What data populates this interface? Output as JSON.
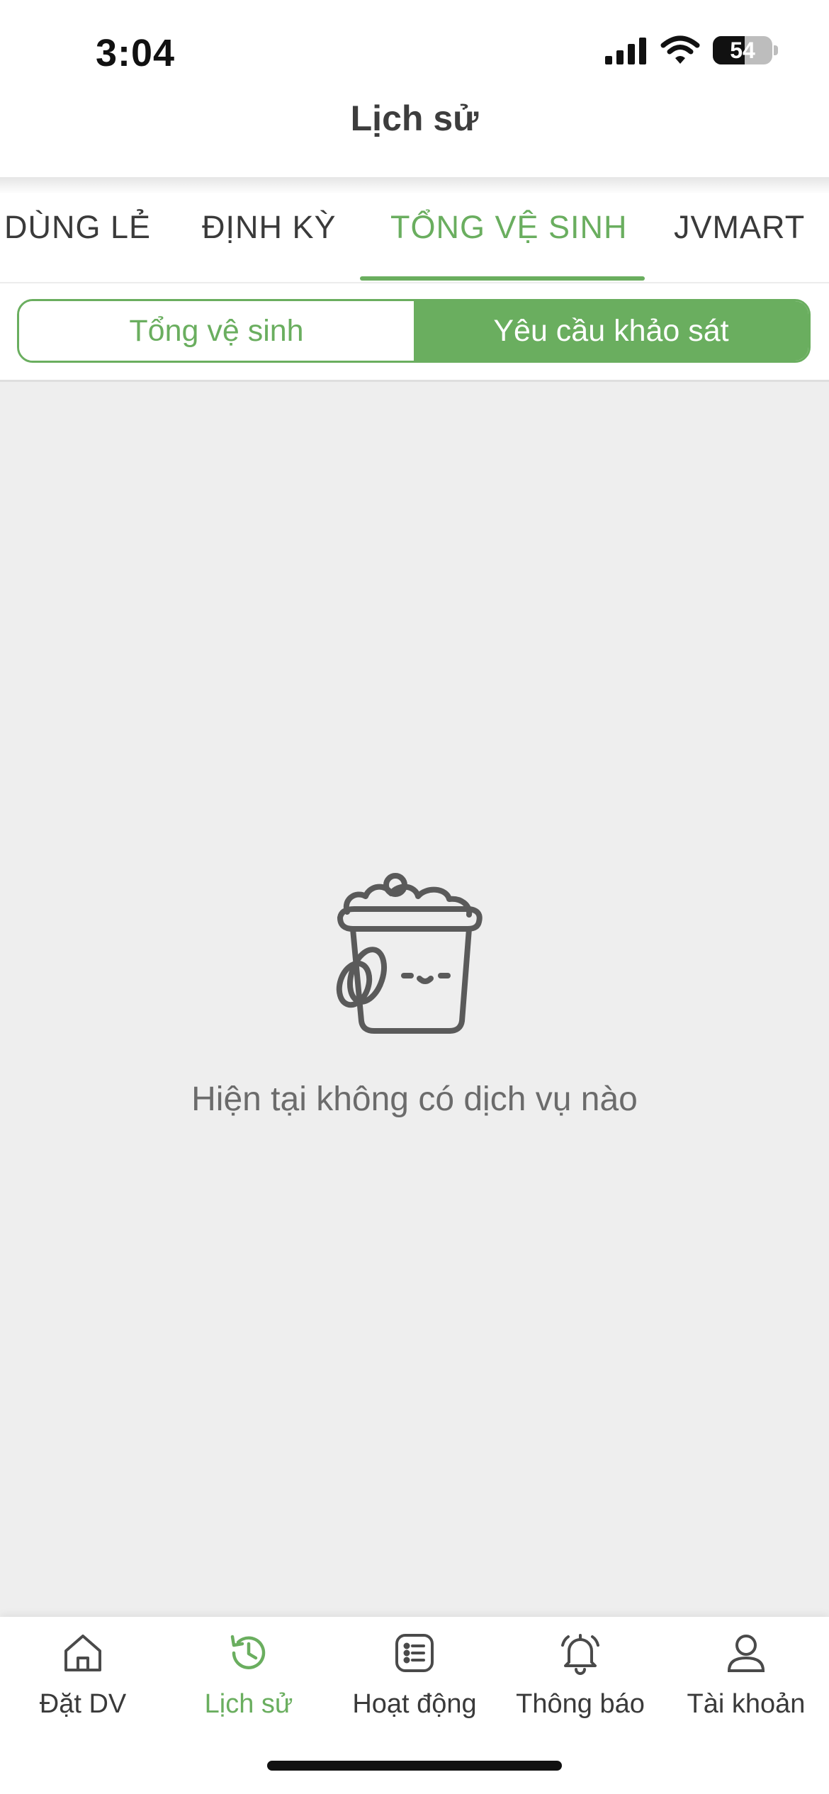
{
  "status_bar": {
    "time": "3:04",
    "battery": "54",
    "battery_fraction": 0.54
  },
  "header": {
    "title": "Lịch sử"
  },
  "tabs": [
    {
      "label": "DÙNG LẺ",
      "active": false
    },
    {
      "label": "ĐỊNH KỲ",
      "active": false
    },
    {
      "label": "TỔNG VỆ SINH",
      "active": true
    },
    {
      "label": "JVMART",
      "active": false
    }
  ],
  "segment": {
    "options": [
      {
        "label": "Tổng vệ sinh",
        "selected": false
      },
      {
        "label": "Yêu cầu khảo sát",
        "selected": true
      }
    ]
  },
  "empty_state": {
    "icon": "bucket-icon",
    "message": "Hiện tại không có dịch vụ nào"
  },
  "bottom_nav": [
    {
      "label": "Đặt DV",
      "icon": "home-icon",
      "active": false
    },
    {
      "label": "Lịch sử",
      "icon": "history-icon",
      "active": true
    },
    {
      "label": "Hoạt động",
      "icon": "list-icon",
      "active": false
    },
    {
      "label": "Thông báo",
      "icon": "bell-icon",
      "active": false
    },
    {
      "label": "Tài khoản",
      "icon": "user-icon",
      "active": false
    }
  ],
  "colors": {
    "accent": "#6aae5f",
    "content_bg": "#eeeeee",
    "text": "#3a3a3a"
  }
}
